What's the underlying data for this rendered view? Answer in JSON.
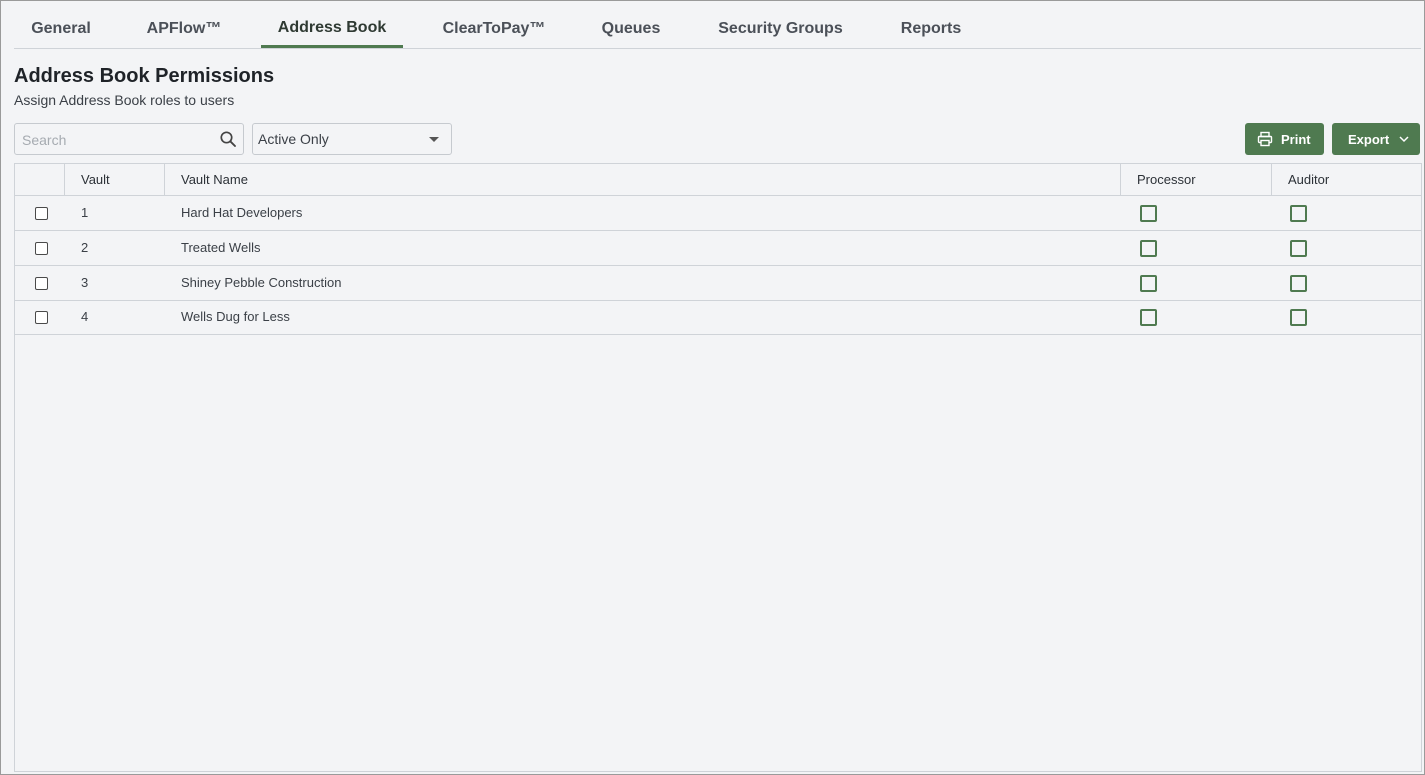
{
  "tabs": [
    {
      "label": "General"
    },
    {
      "label": "APFlow™"
    },
    {
      "label": "Address Book"
    },
    {
      "label": "ClearToPay™"
    },
    {
      "label": "Queues"
    },
    {
      "label": "Security Groups"
    },
    {
      "label": "Reports"
    }
  ],
  "active_tab": "Address Book",
  "header": {
    "title": "Address Book Permissions",
    "subtitle": "Assign Address Book roles to users"
  },
  "toolbar": {
    "search_placeholder": "Search",
    "search_value": "",
    "filter_selected": "Active Only",
    "print_label": "Print",
    "export_label": "Export"
  },
  "table": {
    "columns": [
      "Vault",
      "Vault Name",
      "Processor",
      "Auditor"
    ],
    "rows": [
      {
        "vault": "1",
        "name": "Hard Hat Developers",
        "selected": false,
        "processor": false,
        "auditor": false
      },
      {
        "vault": "2",
        "name": "Treated Wells",
        "selected": false,
        "processor": false,
        "auditor": false
      },
      {
        "vault": "3",
        "name": "Shiney Pebble Construction",
        "selected": false,
        "processor": false,
        "auditor": false
      },
      {
        "vault": "4",
        "name": "Wells Dug for Less",
        "selected": false,
        "processor": false,
        "auditor": false
      }
    ]
  },
  "colors": {
    "accent": "#4f7a50",
    "background": "#f3f4f6",
    "border": "#cfd3d8"
  }
}
